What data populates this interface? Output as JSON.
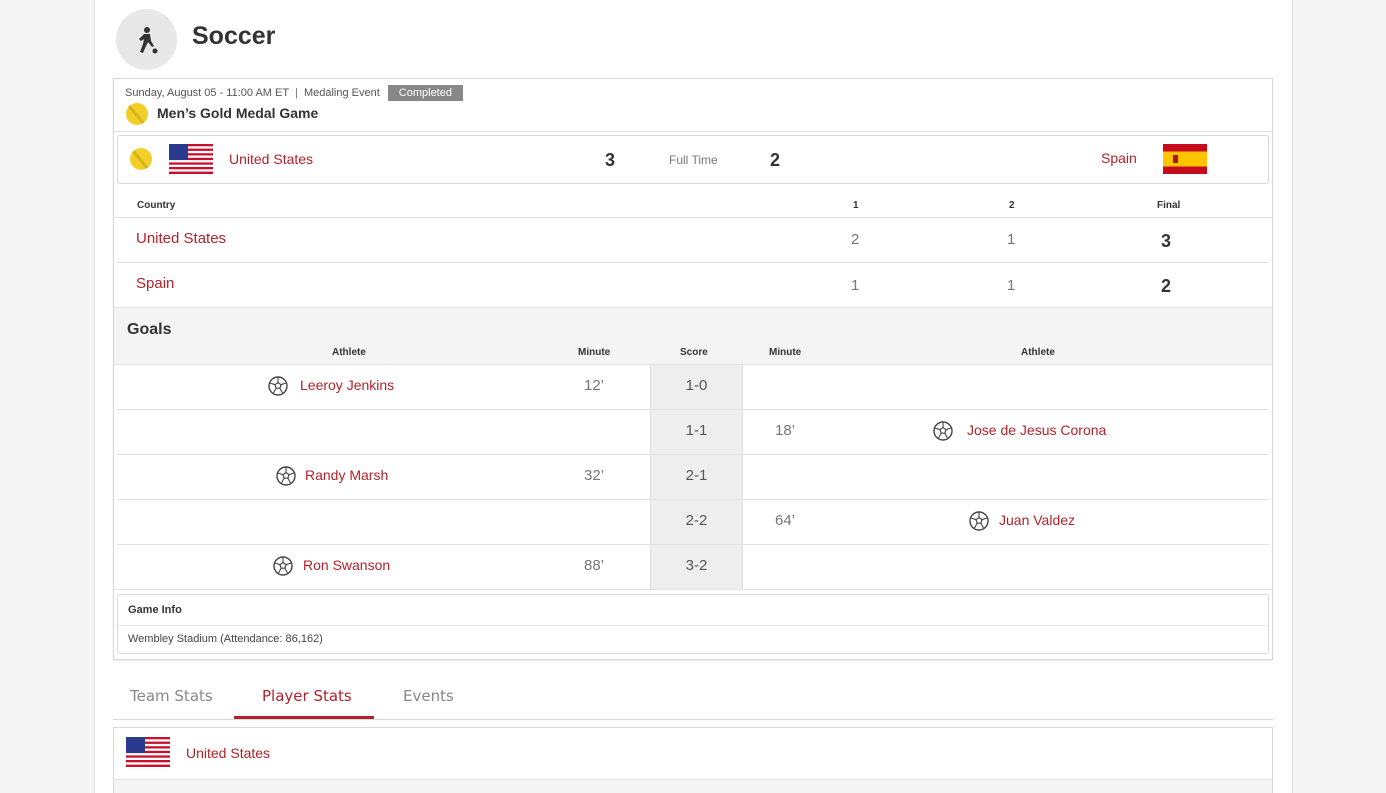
{
  "sport": {
    "title": "Soccer",
    "icon": "soccer-player-icon"
  },
  "event": {
    "datetime": "Sunday, August 05 - 11:00 AM ET",
    "separator": "|",
    "type": "Medaling Event",
    "status": "Completed",
    "title": "Men’s Gold Medal Game",
    "medal": "gold"
  },
  "match": {
    "home": {
      "name": "United States",
      "score": "3",
      "flag": "us-flag"
    },
    "away": {
      "name": "Spain",
      "score": "2",
      "flag": "spain-flag"
    },
    "status": "Full Time"
  },
  "score_table": {
    "headers": {
      "country": "Country",
      "p1": "1",
      "p2": "2",
      "final": "Final"
    },
    "rows": [
      {
        "country": "United States",
        "p1": "2",
        "p2": "1",
        "final": "3"
      },
      {
        "country": "Spain",
        "p1": "1",
        "p2": "1",
        "final": "2"
      }
    ]
  },
  "goals": {
    "title": "Goals",
    "headers": {
      "athlete_left": "Athlete",
      "minute_left": "Minute",
      "score": "Score",
      "minute_right": "Minute",
      "athlete_right": "Athlete"
    },
    "rows": [
      {
        "side": "home",
        "athlete": "Leeroy Jenkins",
        "minute": "12’",
        "score": "1-0"
      },
      {
        "side": "away",
        "athlete": "Jose de Jesus Corona",
        "minute": "18’",
        "score": "1-1"
      },
      {
        "side": "home",
        "athlete": "Randy Marsh",
        "minute": "32’",
        "score": "2-1"
      },
      {
        "side": "away",
        "athlete": "Juan Valdez",
        "minute": "64’",
        "score": "2-2"
      },
      {
        "side": "home",
        "athlete": "Ron Swanson",
        "minute": "88’",
        "score": "3-2"
      }
    ]
  },
  "game_info": {
    "title": "Game Info",
    "venue": "Wembley Stadium (Attendance: 86,162)"
  },
  "tabs": [
    {
      "label": "Team Stats",
      "active": false
    },
    {
      "label": "Player Stats",
      "active": true
    },
    {
      "label": "Events",
      "active": false
    }
  ],
  "player_stats_team": {
    "name": "United States",
    "flag": "us-flag"
  },
  "colors": {
    "accent": "#b3222a",
    "gold": "#f1cf28",
    "badge": "#888888"
  }
}
